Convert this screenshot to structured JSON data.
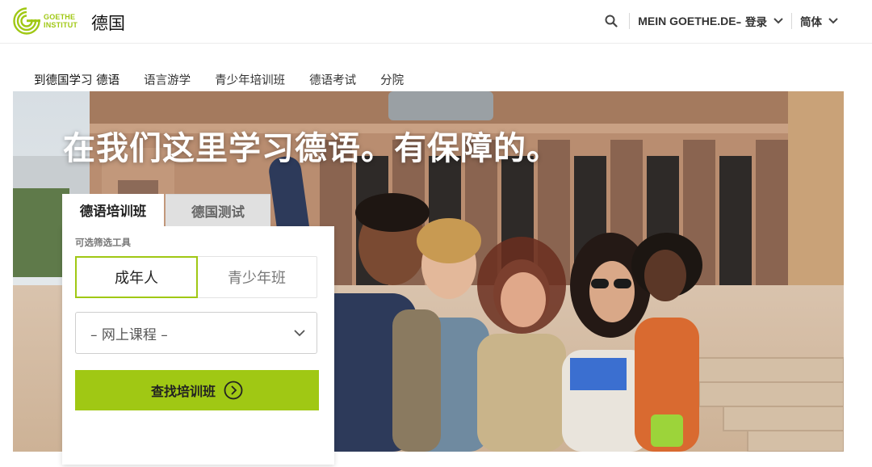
{
  "header": {
    "logo_line1": "GOETHE",
    "logo_line2": "INSTITUT",
    "country": "德国",
    "search_icon": "search-icon",
    "account_prefix": "MEIN GOETHE.DE",
    "account_label": " – 登录",
    "language": "简体"
  },
  "nav": {
    "items": [
      "到德国学习 德语",
      "语言游学",
      "青少年培训班",
      "德语考试",
      "分院"
    ]
  },
  "hero": {
    "title": "在我们这里学习德语。有保障的。"
  },
  "finder": {
    "tab_courses": "德语培训班",
    "tab_exams": "德国测试",
    "filter_label": "可选筛选工具",
    "toggle_adults": "成年人",
    "toggle_youth": "青少年班",
    "select_value": "– 网上课程 –",
    "cta_label": "查找培训班"
  },
  "colors": {
    "brand_green": "#a0c814",
    "text_dark": "#222222",
    "tab_inactive_bg": "#e0e0e0"
  }
}
